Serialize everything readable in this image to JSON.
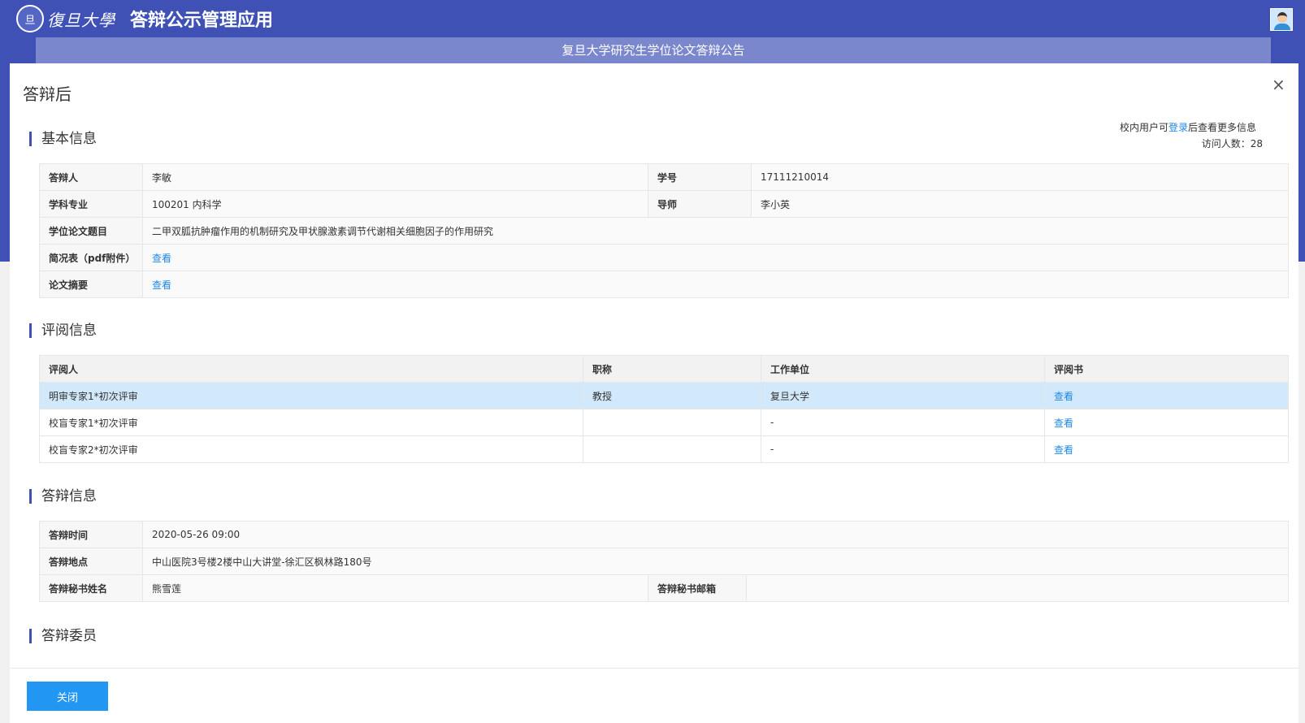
{
  "header": {
    "logo_seal": "旦",
    "logo_text": "復旦大學",
    "app_title": "答辩公示管理应用",
    "announcement": "复旦大学研究生学位论文答辩公告"
  },
  "modal": {
    "title": "答辩后",
    "close_icon": "×",
    "login_tip_prefix": "校内用户可",
    "login_tip_link": "登录",
    "login_tip_suffix": "后查看更多信息",
    "visits": "访问人数：28",
    "close_button": "关闭"
  },
  "basic_info": {
    "title": "基本信息",
    "respondent_label": "答辩人",
    "respondent_value": "李敏",
    "student_id_label": "学号",
    "student_id_value": "17111210014",
    "major_label": "学科专业",
    "major_value": "100201 内科学",
    "advisor_label": "导师",
    "advisor_value": "李小英",
    "thesis_label": "学位论文题目",
    "thesis_value": "二甲双胍抗肿瘤作用的机制研究及甲状腺激素调节代谢相关细胞因子的作用研究",
    "summary_pdf_label": "简况表（pdf附件）",
    "summary_pdf_link": "查看",
    "abstract_label": "论文摘要",
    "abstract_link": "查看"
  },
  "review_info": {
    "title": "评阅信息",
    "headers": [
      "评阅人",
      "职称",
      "工作单位",
      "评阅书"
    ],
    "rows": [
      {
        "reviewer": "明审专家1*初次评审",
        "rank": "教授",
        "unit": "复旦大学",
        "link": "查看"
      },
      {
        "reviewer": "校盲专家1*初次评审",
        "rank": "",
        "unit": "-",
        "link": "查看"
      },
      {
        "reviewer": "校盲专家2*初次评审",
        "rank": "",
        "unit": "-",
        "link": "查看"
      }
    ]
  },
  "defense_info": {
    "title": "答辩信息",
    "time_label": "答辩时间",
    "time_value": "2020-05-26 09:00",
    "place_label": "答辩地点",
    "place_value": "中山医院3号楼2楼中山大讲堂-徐汇区枫林路180号",
    "secretary_label": "答辩秘书姓名",
    "secretary_value": "熊雪莲",
    "secretary_email_label": "答辩秘书邮箱",
    "secretary_email_value": ""
  },
  "committee": {
    "title": "答辩委员"
  }
}
